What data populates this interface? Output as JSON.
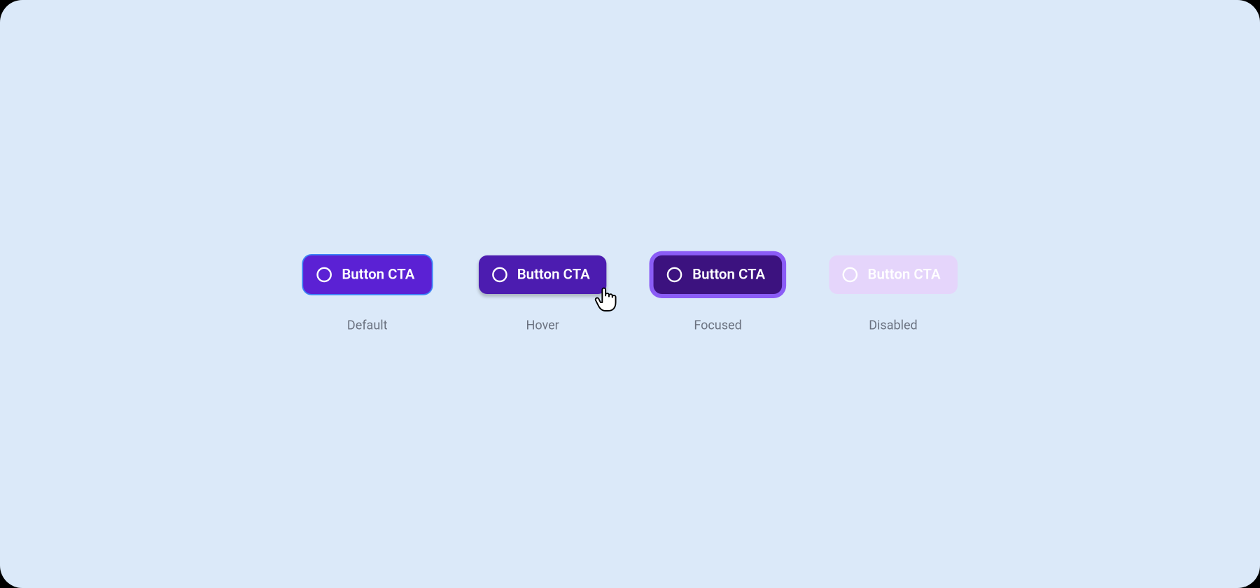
{
  "button_label": "Button CTA",
  "states": {
    "default": {
      "label": "Default"
    },
    "hover": {
      "label": "Hover"
    },
    "focused": {
      "label": "Focused"
    },
    "disabled": {
      "label": "Disabled"
    }
  },
  "colors": {
    "canvas_bg": "#DBE9F9",
    "default_bg": "#5B21D4",
    "default_ring": "#3B82F6",
    "hover_bg": "#4C1CB0",
    "focused_bg": "#3C127F",
    "focused_ring": "#8B5CF6",
    "disabled_bg": "#E5D5FB",
    "label_text": "#6B7280"
  }
}
